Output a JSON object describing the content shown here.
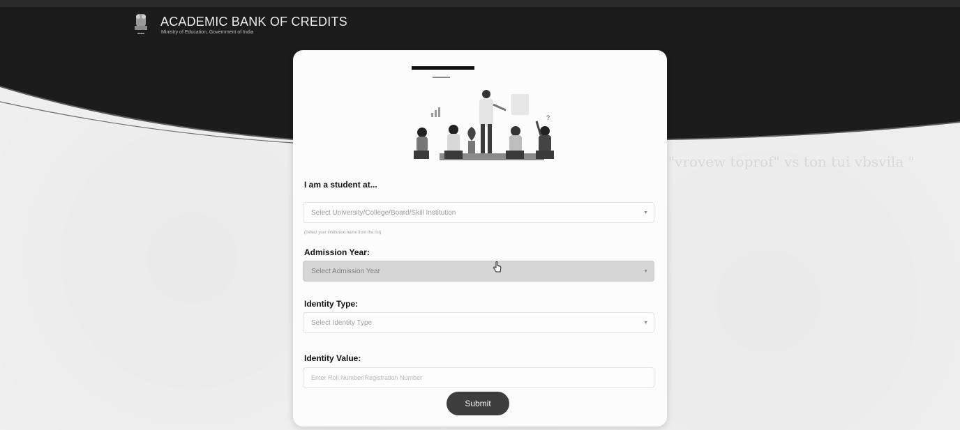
{
  "header": {
    "title": "ACADEMIC BANK OF CREDITS",
    "subtitle": "Ministry of Education, Government of India"
  },
  "form": {
    "student_at_label": "I am a student at...",
    "institution": {
      "placeholder": "Select University/College/Board/Skill Institution",
      "helper": "(Select your institution name from the list)"
    },
    "admission_year": {
      "label": "Admission Year:",
      "placeholder": "Select Admission Year"
    },
    "identity_type": {
      "label": "Identity Type:",
      "placeholder": "Select Identity Type"
    },
    "identity_value": {
      "label": "Identity Value:",
      "placeholder": "Enter Roll Number/Registration Number"
    },
    "submit_label": "Submit"
  },
  "icons": {
    "logo": "national-emblem-icon",
    "dropdown": "chevron-down-icon",
    "cursor": "hand-pointer-icon"
  },
  "colors": {
    "header_band": "#1c1c1c",
    "button": "#3e3e3e",
    "active_select": "#d6d6d6"
  }
}
